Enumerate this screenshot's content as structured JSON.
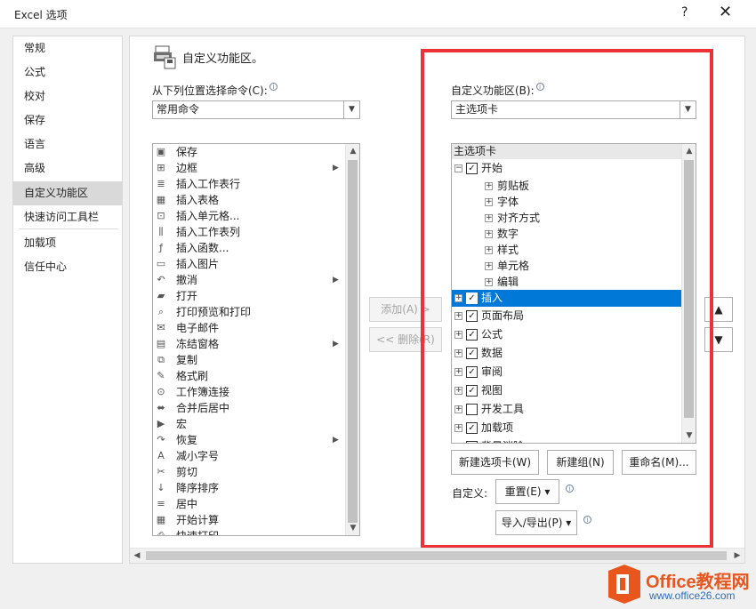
{
  "window": {
    "title": "Excel 选项",
    "help": "?",
    "close": "✕"
  },
  "nav": [
    {
      "label": "常规",
      "active": false
    },
    {
      "label": "公式",
      "active": false
    },
    {
      "label": "校对",
      "active": false
    },
    {
      "label": "保存",
      "active": false
    },
    {
      "label": "语言",
      "active": false
    },
    {
      "label": "高级",
      "active": false
    },
    {
      "label": "自定义功能区",
      "active": true
    },
    {
      "label": "快速访问工具栏",
      "active": false
    },
    {
      "label": "加载项",
      "active": false
    },
    {
      "label": "信任中心",
      "active": false
    }
  ],
  "header": {
    "title": "自定义功能区。",
    "icon": "ribbon-customize-icon"
  },
  "left": {
    "label": "从下列位置选择命令(C):",
    "combo_value": "常用命令",
    "commands": [
      {
        "label": "保存",
        "icon": "save-icon",
        "glyph": "▣",
        "submenu": false
      },
      {
        "label": "边框",
        "icon": "border-icon",
        "glyph": "⊞",
        "submenu": true
      },
      {
        "label": "插入工作表行",
        "icon": "insert-row-icon",
        "glyph": "≣",
        "submenu": false
      },
      {
        "label": "插入表格",
        "icon": "insert-table-icon",
        "glyph": "▦",
        "submenu": false
      },
      {
        "label": "插入单元格...",
        "icon": "insert-cell-icon",
        "glyph": "⊡",
        "submenu": false
      },
      {
        "label": "插入工作表列",
        "icon": "insert-column-icon",
        "glyph": "⫼",
        "submenu": false
      },
      {
        "label": "插入函数...",
        "icon": "function-icon",
        "glyph": "ƒ",
        "submenu": false
      },
      {
        "label": "插入图片",
        "icon": "picture-icon",
        "glyph": "▭",
        "submenu": false
      },
      {
        "label": "撤消",
        "icon": "undo-icon",
        "glyph": "↶",
        "submenu": true
      },
      {
        "label": "打开",
        "icon": "open-folder-icon",
        "glyph": "▰",
        "submenu": false
      },
      {
        "label": "打印预览和打印",
        "icon": "print-preview-icon",
        "glyph": "⌕",
        "submenu": false
      },
      {
        "label": "电子邮件",
        "icon": "email-icon",
        "glyph": "✉",
        "submenu": false
      },
      {
        "label": "冻结窗格",
        "icon": "freeze-panes-icon",
        "glyph": "▤",
        "submenu": true
      },
      {
        "label": "复制",
        "icon": "copy-icon",
        "glyph": "⧉",
        "submenu": false
      },
      {
        "label": "格式刷",
        "icon": "format-painter-icon",
        "glyph": "✎",
        "submenu": false
      },
      {
        "label": "工作簿连接",
        "icon": "connections-icon",
        "glyph": "⊙",
        "submenu": false
      },
      {
        "label": "合并后居中",
        "icon": "merge-center-icon",
        "glyph": "⬌",
        "submenu": false
      },
      {
        "label": "宏",
        "icon": "macro-icon",
        "glyph": "▶",
        "submenu": false
      },
      {
        "label": "恢复",
        "icon": "redo-icon",
        "glyph": "↷",
        "submenu": true
      },
      {
        "label": "减小字号",
        "icon": "font-smaller-icon",
        "glyph": "A",
        "submenu": false
      },
      {
        "label": "剪切",
        "icon": "cut-icon",
        "glyph": "✂",
        "submenu": false
      },
      {
        "label": "降序排序",
        "icon": "sort-desc-icon",
        "glyph": "↓",
        "submenu": false
      },
      {
        "label": "居中",
        "icon": "center-icon",
        "glyph": "≡",
        "submenu": false
      },
      {
        "label": "开始计算",
        "icon": "calculate-icon",
        "glyph": "▦",
        "submenu": false
      },
      {
        "label": "快速打印",
        "icon": "quick-print-icon",
        "glyph": "⎙",
        "submenu": false
      }
    ]
  },
  "middle": {
    "add_label": "添加(A) >",
    "remove_label": "<< 删除(R)"
  },
  "right": {
    "label": "自定义功能区(B):",
    "combo_value": "主选项卡",
    "tree_header": "主选项卡",
    "tree": [
      {
        "label": "开始",
        "level": 0,
        "expander": "⊟",
        "checked": true,
        "selected": false
      },
      {
        "label": "剪贴板",
        "level": 1,
        "expander": "⊞",
        "checked": null,
        "selected": false
      },
      {
        "label": "字体",
        "level": 1,
        "expander": "⊞",
        "checked": null,
        "selected": false
      },
      {
        "label": "对齐方式",
        "level": 1,
        "expander": "⊞",
        "checked": null,
        "selected": false
      },
      {
        "label": "数字",
        "level": 1,
        "expander": "⊞",
        "checked": null,
        "selected": false
      },
      {
        "label": "样式",
        "level": 1,
        "expander": "⊞",
        "checked": null,
        "selected": false
      },
      {
        "label": "单元格",
        "level": 1,
        "expander": "⊞",
        "checked": null,
        "selected": false
      },
      {
        "label": "编辑",
        "level": 1,
        "expander": "⊞",
        "checked": null,
        "selected": false
      },
      {
        "label": "插入",
        "level": 0,
        "expander": "⊞",
        "checked": true,
        "selected": true
      },
      {
        "label": "页面布局",
        "level": 0,
        "expander": "⊞",
        "checked": true,
        "selected": false
      },
      {
        "label": "公式",
        "level": 0,
        "expander": "⊞",
        "checked": true,
        "selected": false
      },
      {
        "label": "数据",
        "level": 0,
        "expander": "⊞",
        "checked": true,
        "selected": false
      },
      {
        "label": "审阅",
        "level": 0,
        "expander": "⊞",
        "checked": true,
        "selected": false
      },
      {
        "label": "视图",
        "level": 0,
        "expander": "⊞",
        "checked": true,
        "selected": false
      },
      {
        "label": "开发工具",
        "level": 0,
        "expander": "⊞",
        "checked": false,
        "selected": false
      },
      {
        "label": "加载项",
        "level": 0,
        "expander": "⊞",
        "checked": true,
        "selected": false
      },
      {
        "label": "背景消除",
        "level": 0,
        "expander": "⊞",
        "checked": true,
        "selected": false
      }
    ],
    "new_tab_label": "新建选项卡(W)",
    "new_group_label": "新建组(N)",
    "rename_label": "重命名(M)...",
    "customize_label": "自定义:",
    "reset_label": "重置(E) ▾",
    "import_export_label": "导入/导出(P) ▾",
    "move_up": "▲",
    "move_down": "▼"
  },
  "watermark": {
    "brand": "Office教程网",
    "url": "www.office26.com"
  },
  "colors": {
    "highlight": "#0078d7",
    "annotation_box": "#ec3237",
    "nav_active": "#d9d9d9"
  }
}
